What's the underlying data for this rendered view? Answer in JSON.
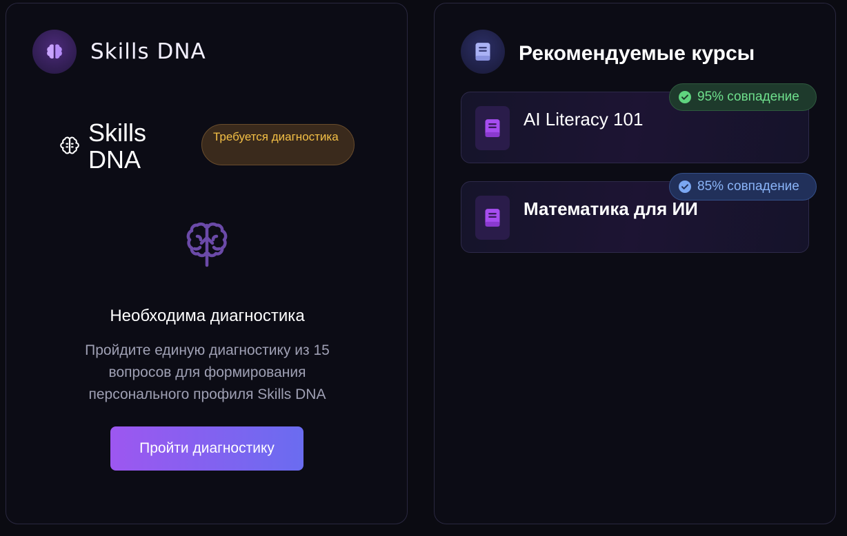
{
  "left_panel": {
    "header_title": "Skills DNA",
    "sub_title": "Skills DNA",
    "status_badge": "Требуется диагностика",
    "heading": "Необходима диагностика",
    "description": "Пройдите единую диагностику из 15 вопросов для формирования персонального профиля Skills DNA",
    "button_label": "Пройти диагностику"
  },
  "right_panel": {
    "header_title": "Рекомендуемые курсы",
    "courses": [
      {
        "title": "AI Literacy 101",
        "match": "95% совпадение",
        "match_color": "#6fe08d"
      },
      {
        "title": "Математика для ИИ",
        "match": "85% совпадение",
        "match_color": "#8ab4f8"
      }
    ]
  },
  "colors": {
    "accent_purple": "#9d57f0",
    "accent_blue": "#6a6cf0",
    "badge_warning": "#f4c046",
    "background": "#0b0b12"
  },
  "icons": {
    "left_header": "brain-icon",
    "sub_header": "brain-outline-icon",
    "diagnostic": "brain-large-icon",
    "right_header": "book-icon",
    "course": "book-icon",
    "match": "check-circle-icon"
  }
}
